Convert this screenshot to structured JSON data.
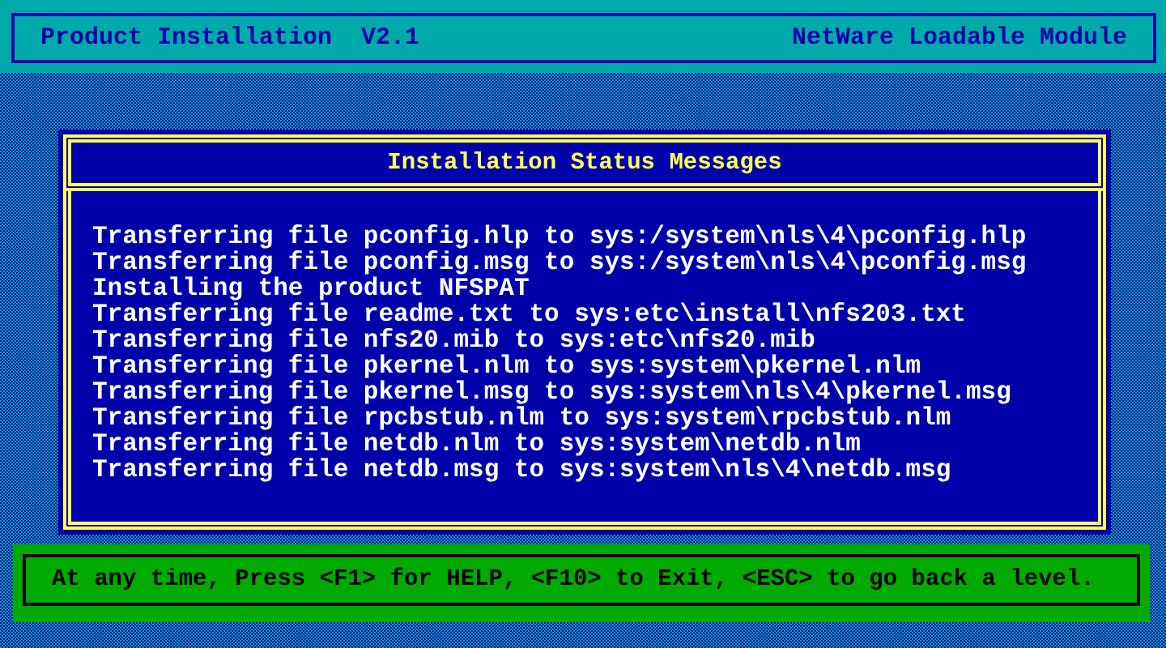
{
  "header": {
    "title": "Product Installation  V2.1",
    "subtitle": "NetWare Loadable Module"
  },
  "dialog": {
    "title": "Installation Status Messages",
    "lines": [
      "Transferring file pconfig.hlp to sys:/system\\nls\\4\\pconfig.hlp",
      "Transferring file pconfig.msg to sys:/system\\nls\\4\\pconfig.msg",
      "Installing the product NFSPAT",
      "Transferring file readme.txt to sys:etc\\install\\nfs203.txt",
      "Transferring file nfs20.mib to sys:etc\\nfs20.mib",
      "Transferring file pkernel.nlm to sys:system\\pkernel.nlm",
      "Transferring file pkernel.msg to sys:system\\nls\\4\\pkernel.msg",
      "Transferring file rpcbstub.nlm to sys:system\\rpcbstub.nlm",
      "Transferring file netdb.nlm to sys:system\\netdb.nlm",
      "Transferring file netdb.msg to sys:system\\nls\\4\\netdb.msg"
    ]
  },
  "help_bar": {
    "text": "At any time, Press <F1> for HELP, <F10> to Exit, <ESC> to go back a level."
  }
}
